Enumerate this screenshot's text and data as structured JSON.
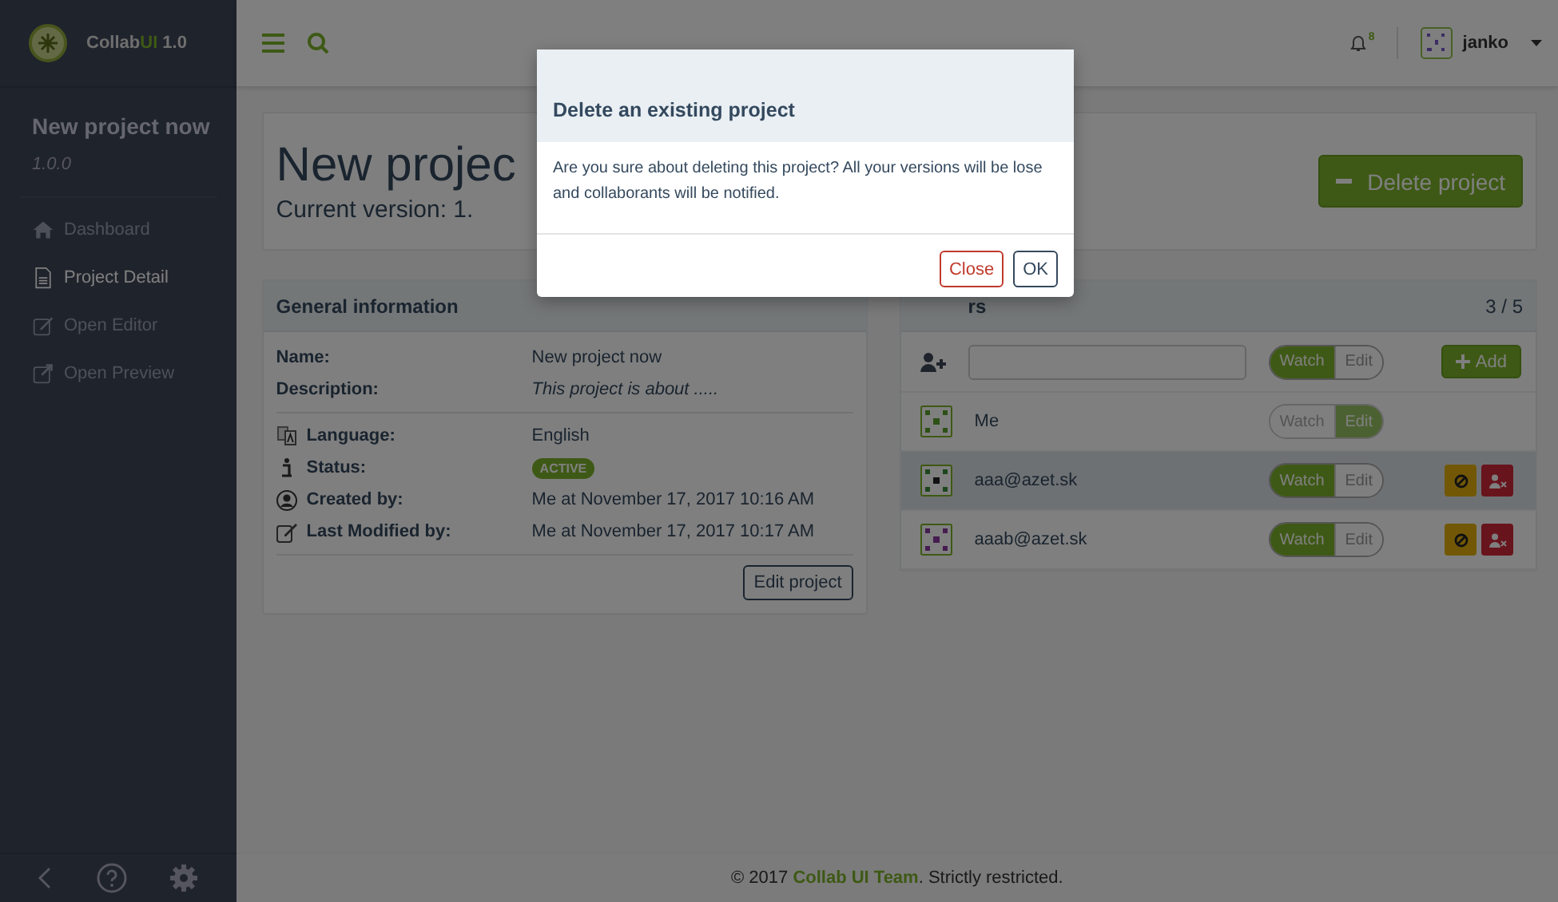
{
  "brand": {
    "name": "Collab",
    "accent": "UI",
    "version": "1.0"
  },
  "sidebar": {
    "project": "New project now",
    "version": "1.0.0",
    "items": [
      {
        "label": "Dashboard",
        "selected": false
      },
      {
        "label": "Project Detail",
        "selected": true
      },
      {
        "label": "Open Editor",
        "selected": false
      },
      {
        "label": "Open Preview",
        "selected": false
      }
    ]
  },
  "topbar": {
    "notifications": "8",
    "user": "janko"
  },
  "project": {
    "title": "New projec",
    "subtitle": "Current version: 1.",
    "delete_button": "Delete project"
  },
  "general": {
    "title": "General information",
    "fields": [
      {
        "label": "Name:",
        "value": "New project now",
        "kind": "plain"
      },
      {
        "label": "Description:",
        "value": "This project is about .....",
        "kind": "italic"
      }
    ],
    "details": [
      {
        "label": "Language:",
        "value": "English",
        "kind": "plain"
      },
      {
        "label": "Status:",
        "value": "ACTIVE",
        "kind": "badge"
      },
      {
        "label": "Created by:",
        "value": "Me at November 17, 2017 10:16 AM",
        "kind": "plain"
      },
      {
        "label": "Last Modified by:",
        "value": "Me at November 17, 2017 10:17 AM",
        "kind": "plain"
      }
    ],
    "edit_button": "Edit project"
  },
  "collaborators": {
    "title": "rs",
    "count": "3 / 5",
    "add_row": {
      "watch": {
        "label": "Watch",
        "selected": true
      },
      "edit": {
        "label": "Edit",
        "selected": false
      },
      "add_button": "Add"
    },
    "rows": [
      {
        "name": "Me",
        "disabled": true,
        "actions": false,
        "selected": false,
        "watch": {
          "label": "Watch",
          "selected": false
        },
        "edit": {
          "label": "Edit",
          "selected": true
        }
      },
      {
        "name": "aaa@azet.sk",
        "disabled": false,
        "actions": true,
        "selected": true,
        "watch": {
          "label": "Watch",
          "selected": true
        },
        "edit": {
          "label": "Edit",
          "selected": false
        }
      },
      {
        "name": "aaab@azet.sk",
        "disabled": false,
        "actions": true,
        "selected": false,
        "watch": {
          "label": "Watch",
          "selected": true
        },
        "edit": {
          "label": "Edit",
          "selected": false
        }
      }
    ]
  },
  "footer": {
    "prefix": "© 2017 ",
    "link": "Collab UI Team",
    "suffix": ". Strictly restricted."
  },
  "modal": {
    "title": "Delete an existing project",
    "body": "Are you sure about deleting this project? All your versions will be lose and collaborants will be notified.",
    "buttons": [
      {
        "label": "Close",
        "kind": "danger"
      },
      {
        "label": "OK",
        "kind": "default"
      }
    ]
  }
}
